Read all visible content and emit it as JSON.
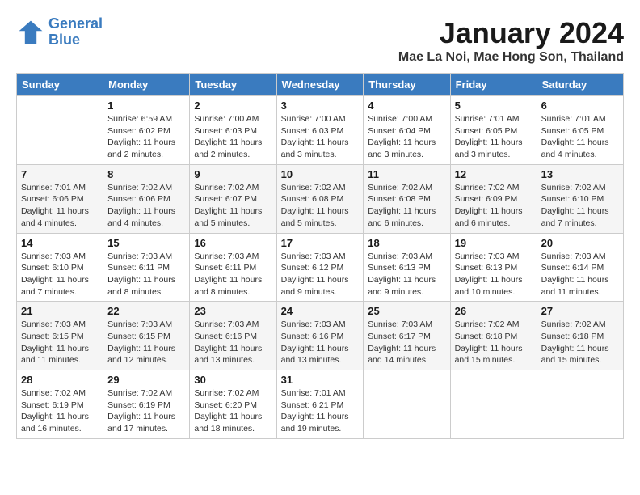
{
  "logo": {
    "line1": "General",
    "line2": "Blue"
  },
  "title": "January 2024",
  "location": "Mae La Noi, Mae Hong Son, Thailand",
  "weekdays": [
    "Sunday",
    "Monday",
    "Tuesday",
    "Wednesday",
    "Thursday",
    "Friday",
    "Saturday"
  ],
  "weeks": [
    [
      {
        "day": "",
        "sunrise": "",
        "sunset": "",
        "daylight": ""
      },
      {
        "day": "1",
        "sunrise": "Sunrise: 6:59 AM",
        "sunset": "Sunset: 6:02 PM",
        "daylight": "Daylight: 11 hours and 2 minutes."
      },
      {
        "day": "2",
        "sunrise": "Sunrise: 7:00 AM",
        "sunset": "Sunset: 6:03 PM",
        "daylight": "Daylight: 11 hours and 2 minutes."
      },
      {
        "day": "3",
        "sunrise": "Sunrise: 7:00 AM",
        "sunset": "Sunset: 6:03 PM",
        "daylight": "Daylight: 11 hours and 3 minutes."
      },
      {
        "day": "4",
        "sunrise": "Sunrise: 7:00 AM",
        "sunset": "Sunset: 6:04 PM",
        "daylight": "Daylight: 11 hours and 3 minutes."
      },
      {
        "day": "5",
        "sunrise": "Sunrise: 7:01 AM",
        "sunset": "Sunset: 6:05 PM",
        "daylight": "Daylight: 11 hours and 3 minutes."
      },
      {
        "day": "6",
        "sunrise": "Sunrise: 7:01 AM",
        "sunset": "Sunset: 6:05 PM",
        "daylight": "Daylight: 11 hours and 4 minutes."
      }
    ],
    [
      {
        "day": "7",
        "sunrise": "Sunrise: 7:01 AM",
        "sunset": "Sunset: 6:06 PM",
        "daylight": "Daylight: 11 hours and 4 minutes."
      },
      {
        "day": "8",
        "sunrise": "Sunrise: 7:02 AM",
        "sunset": "Sunset: 6:06 PM",
        "daylight": "Daylight: 11 hours and 4 minutes."
      },
      {
        "day": "9",
        "sunrise": "Sunrise: 7:02 AM",
        "sunset": "Sunset: 6:07 PM",
        "daylight": "Daylight: 11 hours and 5 minutes."
      },
      {
        "day": "10",
        "sunrise": "Sunrise: 7:02 AM",
        "sunset": "Sunset: 6:08 PM",
        "daylight": "Daylight: 11 hours and 5 minutes."
      },
      {
        "day": "11",
        "sunrise": "Sunrise: 7:02 AM",
        "sunset": "Sunset: 6:08 PM",
        "daylight": "Daylight: 11 hours and 6 minutes."
      },
      {
        "day": "12",
        "sunrise": "Sunrise: 7:02 AM",
        "sunset": "Sunset: 6:09 PM",
        "daylight": "Daylight: 11 hours and 6 minutes."
      },
      {
        "day": "13",
        "sunrise": "Sunrise: 7:02 AM",
        "sunset": "Sunset: 6:10 PM",
        "daylight": "Daylight: 11 hours and 7 minutes."
      }
    ],
    [
      {
        "day": "14",
        "sunrise": "Sunrise: 7:03 AM",
        "sunset": "Sunset: 6:10 PM",
        "daylight": "Daylight: 11 hours and 7 minutes."
      },
      {
        "day": "15",
        "sunrise": "Sunrise: 7:03 AM",
        "sunset": "Sunset: 6:11 PM",
        "daylight": "Daylight: 11 hours and 8 minutes."
      },
      {
        "day": "16",
        "sunrise": "Sunrise: 7:03 AM",
        "sunset": "Sunset: 6:11 PM",
        "daylight": "Daylight: 11 hours and 8 minutes."
      },
      {
        "day": "17",
        "sunrise": "Sunrise: 7:03 AM",
        "sunset": "Sunset: 6:12 PM",
        "daylight": "Daylight: 11 hours and 9 minutes."
      },
      {
        "day": "18",
        "sunrise": "Sunrise: 7:03 AM",
        "sunset": "Sunset: 6:13 PM",
        "daylight": "Daylight: 11 hours and 9 minutes."
      },
      {
        "day": "19",
        "sunrise": "Sunrise: 7:03 AM",
        "sunset": "Sunset: 6:13 PM",
        "daylight": "Daylight: 11 hours and 10 minutes."
      },
      {
        "day": "20",
        "sunrise": "Sunrise: 7:03 AM",
        "sunset": "Sunset: 6:14 PM",
        "daylight": "Daylight: 11 hours and 11 minutes."
      }
    ],
    [
      {
        "day": "21",
        "sunrise": "Sunrise: 7:03 AM",
        "sunset": "Sunset: 6:15 PM",
        "daylight": "Daylight: 11 hours and 11 minutes."
      },
      {
        "day": "22",
        "sunrise": "Sunrise: 7:03 AM",
        "sunset": "Sunset: 6:15 PM",
        "daylight": "Daylight: 11 hours and 12 minutes."
      },
      {
        "day": "23",
        "sunrise": "Sunrise: 7:03 AM",
        "sunset": "Sunset: 6:16 PM",
        "daylight": "Daylight: 11 hours and 13 minutes."
      },
      {
        "day": "24",
        "sunrise": "Sunrise: 7:03 AM",
        "sunset": "Sunset: 6:16 PM",
        "daylight": "Daylight: 11 hours and 13 minutes."
      },
      {
        "day": "25",
        "sunrise": "Sunrise: 7:03 AM",
        "sunset": "Sunset: 6:17 PM",
        "daylight": "Daylight: 11 hours and 14 minutes."
      },
      {
        "day": "26",
        "sunrise": "Sunrise: 7:02 AM",
        "sunset": "Sunset: 6:18 PM",
        "daylight": "Daylight: 11 hours and 15 minutes."
      },
      {
        "day": "27",
        "sunrise": "Sunrise: 7:02 AM",
        "sunset": "Sunset: 6:18 PM",
        "daylight": "Daylight: 11 hours and 15 minutes."
      }
    ],
    [
      {
        "day": "28",
        "sunrise": "Sunrise: 7:02 AM",
        "sunset": "Sunset: 6:19 PM",
        "daylight": "Daylight: 11 hours and 16 minutes."
      },
      {
        "day": "29",
        "sunrise": "Sunrise: 7:02 AM",
        "sunset": "Sunset: 6:19 PM",
        "daylight": "Daylight: 11 hours and 17 minutes."
      },
      {
        "day": "30",
        "sunrise": "Sunrise: 7:02 AM",
        "sunset": "Sunset: 6:20 PM",
        "daylight": "Daylight: 11 hours and 18 minutes."
      },
      {
        "day": "31",
        "sunrise": "Sunrise: 7:01 AM",
        "sunset": "Sunset: 6:21 PM",
        "daylight": "Daylight: 11 hours and 19 minutes."
      },
      {
        "day": "",
        "sunrise": "",
        "sunset": "",
        "daylight": ""
      },
      {
        "day": "",
        "sunrise": "",
        "sunset": "",
        "daylight": ""
      },
      {
        "day": "",
        "sunrise": "",
        "sunset": "",
        "daylight": ""
      }
    ]
  ]
}
